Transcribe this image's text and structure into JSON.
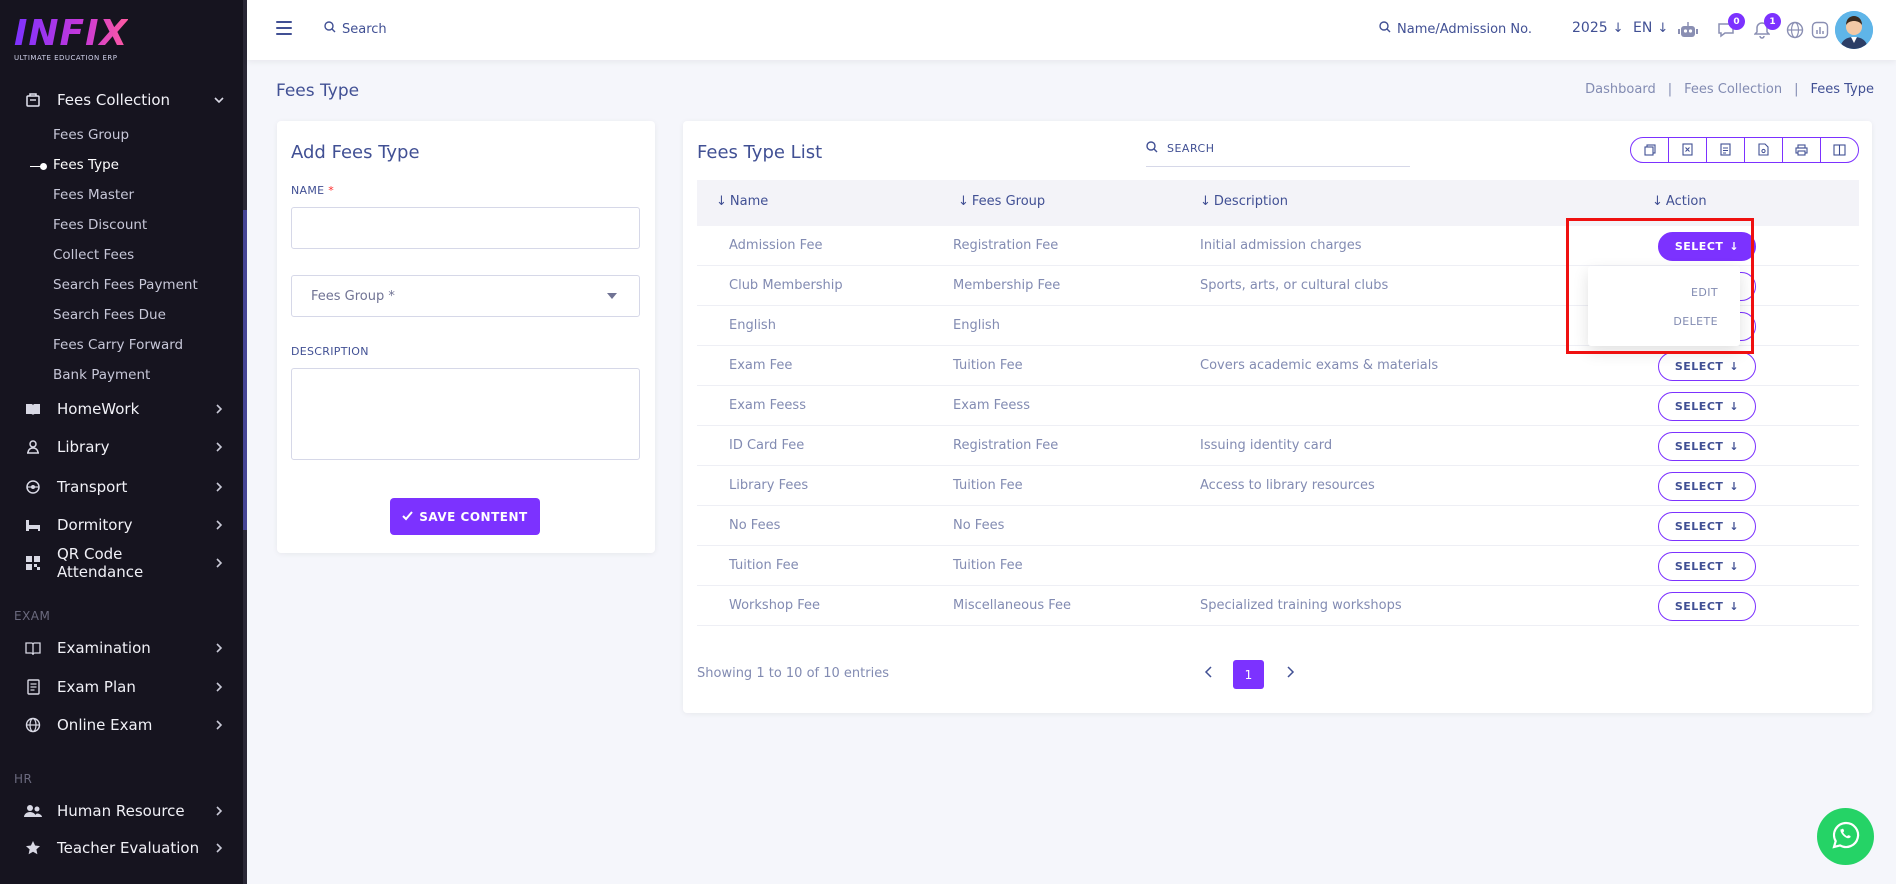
{
  "brand": {
    "logo_text": "INFIX",
    "tagline": "ULTIMATE EDUCATION ERP"
  },
  "sidebar": {
    "fees_collection": {
      "label": "Fees Collection",
      "items": [
        {
          "label": "Fees Group"
        },
        {
          "label": "Fees Type",
          "active": true
        },
        {
          "label": "Fees Master"
        },
        {
          "label": "Fees Discount"
        },
        {
          "label": "Collect Fees"
        },
        {
          "label": "Search Fees Payment"
        },
        {
          "label": "Search Fees Due"
        },
        {
          "label": "Fees Carry Forward"
        },
        {
          "label": "Bank Payment"
        }
      ]
    },
    "menu": [
      {
        "label": "HomeWork",
        "icon": "book-icon"
      },
      {
        "label": "Library",
        "icon": "library-icon"
      },
      {
        "label": "Transport",
        "icon": "bus-icon"
      },
      {
        "label": "Dormitory",
        "icon": "bed-icon"
      },
      {
        "label": "QR Code Attendance",
        "icon": "qr-code-icon"
      }
    ],
    "exam_section": "EXAM",
    "exam_menu": [
      {
        "label": "Examination",
        "icon": "book-open-icon"
      },
      {
        "label": "Exam Plan",
        "icon": "document-icon"
      },
      {
        "label": "Online Exam",
        "icon": "globe-icon"
      }
    ],
    "hr_section": "HR",
    "hr_menu": [
      {
        "label": "Human Resource",
        "icon": "users-icon"
      },
      {
        "label": "Teacher Evaluation",
        "icon": "star-icon"
      }
    ]
  },
  "header": {
    "search_label": "Search",
    "name_search_label": "Name/Admission No.",
    "year": "2025",
    "language": "EN",
    "messages_badge": "0",
    "notifications_badge": "1"
  },
  "page": {
    "title": "Fees Type",
    "breadcrumb": [
      "Dashboard",
      "Fees Collection",
      "Fees Type"
    ]
  },
  "form": {
    "title": "Add Fees Type",
    "name_label": "NAME",
    "name_required": "*",
    "name_value": "",
    "fees_group_placeholder": "Fees Group *",
    "description_label": "DESCRIPTION",
    "description_value": "",
    "save_label": "SAVE CONTENT"
  },
  "list": {
    "title": "Fees Type List",
    "search_placeholder": "SEARCH",
    "columns": [
      "Name",
      "Fees Group",
      "Description",
      "Action"
    ],
    "rows": [
      {
        "name": "Admission Fee",
        "group": "Registration Fee",
        "description": "Initial admission charges"
      },
      {
        "name": "Club Membership",
        "group": "Membership Fee",
        "description": "Sports, arts, or cultural clubs"
      },
      {
        "name": "English",
        "group": "English",
        "description": ""
      },
      {
        "name": "Exam Fee",
        "group": "Tuition Fee",
        "description": "Covers academic exams & materials"
      },
      {
        "name": "Exam Feess",
        "group": "Exam Feess",
        "description": ""
      },
      {
        "name": "ID Card Fee",
        "group": "Registration Fee",
        "description": "Issuing identity card"
      },
      {
        "name": "Library Fees",
        "group": "Tuition Fee",
        "description": "Access to library resources"
      },
      {
        "name": "No Fees",
        "group": "No Fees",
        "description": ""
      },
      {
        "name": "Tuition Fee",
        "group": "Tuition Fee",
        "description": ""
      },
      {
        "name": "Workshop Fee",
        "group": "Miscellaneous Fee",
        "description": "Specialized training workshops"
      }
    ],
    "select_label": "SELECT",
    "dropdown": {
      "edit_label": "EDIT",
      "delete_label": "DELETE"
    },
    "showing_text": "Showing 1 to 10 of 10 entries",
    "current_page": "1"
  },
  "colors": {
    "accent": "#7c32ff",
    "text": "#415094",
    "muted": "#828bb2",
    "highlight": "#ef1010"
  }
}
